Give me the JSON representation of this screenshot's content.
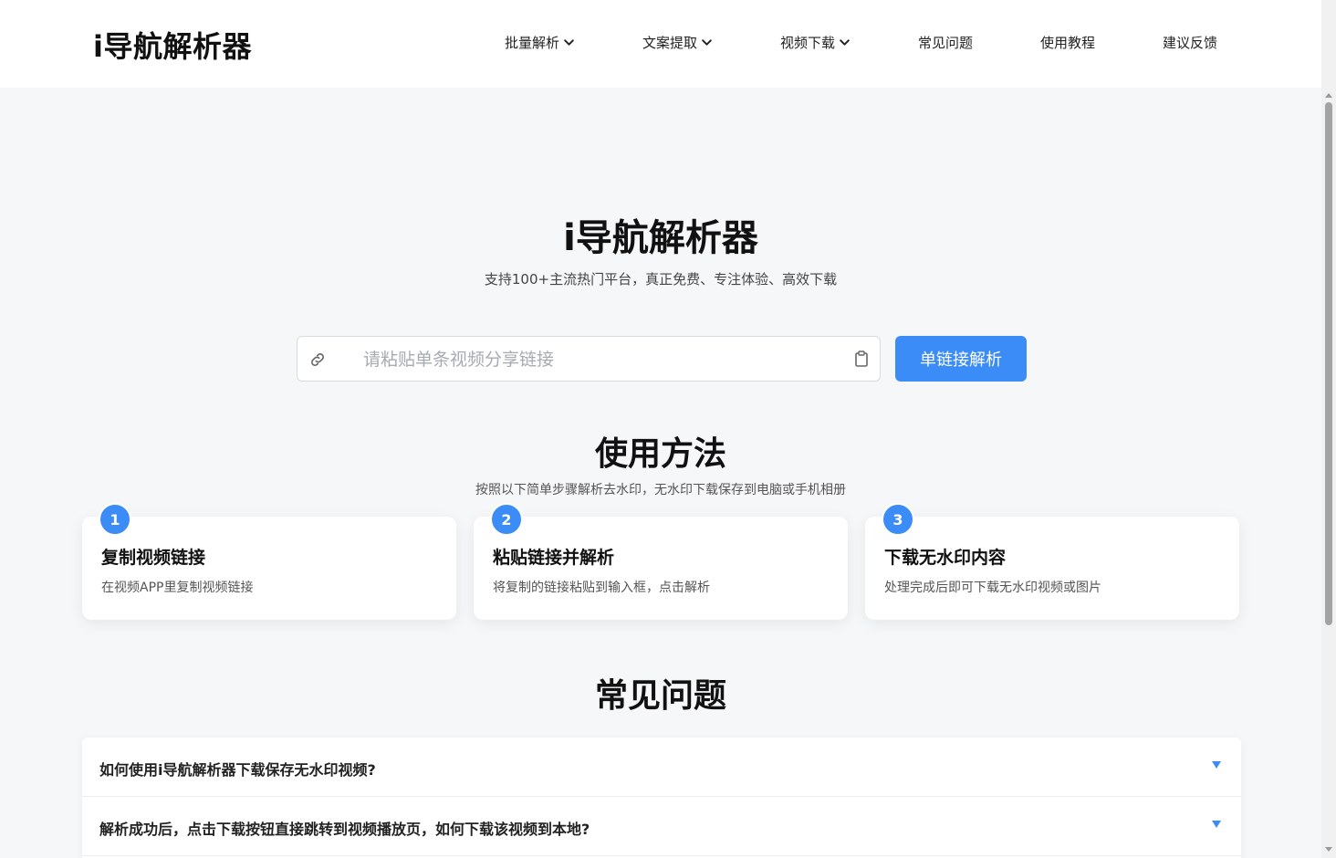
{
  "header": {
    "logo": "i导航解析器",
    "nav": [
      {
        "label": "批量解析",
        "has_dropdown": true
      },
      {
        "label": "文案提取",
        "has_dropdown": true
      },
      {
        "label": "视频下载",
        "has_dropdown": true
      },
      {
        "label": "常见问题",
        "has_dropdown": false
      },
      {
        "label": "使用教程",
        "has_dropdown": false
      },
      {
        "label": "建议反馈",
        "has_dropdown": false
      }
    ]
  },
  "hero": {
    "title": "i导航解析器",
    "subtitle": "支持100+主流热门平台，真正免费、专注体验、高效下载",
    "search": {
      "placeholder": "请粘贴单条视频分享链接",
      "value": ""
    },
    "button_label": "单链接解析"
  },
  "usage": {
    "title": "使用方法",
    "subtitle": "按照以下简单步骤解析去水印，无水印下载保存到电脑或手机相册",
    "steps": [
      {
        "number": "1",
        "title": "复制视频链接",
        "desc": "在视频APP里复制视频链接"
      },
      {
        "number": "2",
        "title": "粘贴链接并解析",
        "desc": "将复制的链接粘贴到输入框，点击解析"
      },
      {
        "number": "3",
        "title": "下载无水印内容",
        "desc": "处理完成后即可下载无水印视频或图片"
      }
    ]
  },
  "faq": {
    "title": "常见问题",
    "items": [
      {
        "question": "如何使用i导航解析器下载保存无水印视频?"
      },
      {
        "question": "解析成功后，点击下载按钮直接跳转到视频播放页，如何下载该视频到本地?"
      }
    ]
  },
  "colors": {
    "accent": "#3b8cf6",
    "page_bg": "#f6f7f9"
  },
  "icons": {
    "search_left": "link-icon",
    "search_right": "clipboard-icon",
    "nav_dropdown": "chevron-down-icon",
    "faq_toggle": "triangle-down-icon"
  }
}
